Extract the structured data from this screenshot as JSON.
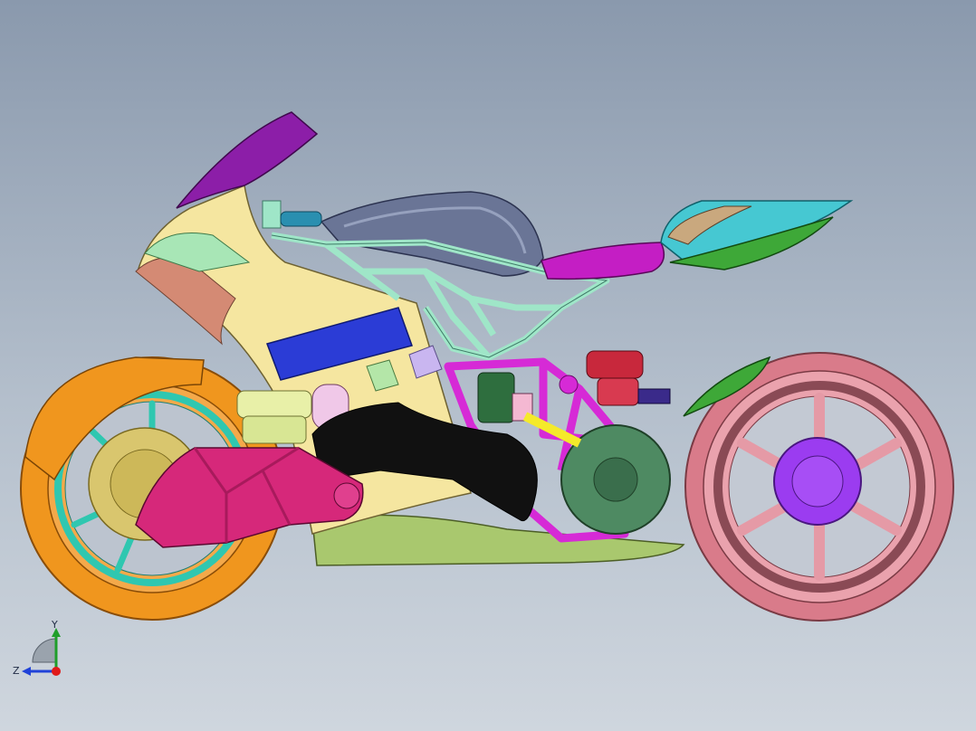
{
  "viewport": {
    "background_top": "#8a99ad",
    "background_bottom": "#cfd6de"
  },
  "model": {
    "name": "motorcycle-assembly",
    "colors": {
      "front_tire": "#f0961e",
      "front_rim": "#2fc7b0",
      "rear_tire": "#e6909c",
      "rear_hub": "#9b3cf0",
      "fairing": "#f5e6a0",
      "windscreen": "#8c1ea8",
      "tank": "#6a7596",
      "lattice_frame": "#9fe6c8",
      "rear_frame": "#d62ad6",
      "swingarm": "#d6287a",
      "seat": "#c41ec4",
      "tail": "#46c8d2",
      "tail_green": "#3ea838",
      "blue_panel": "#2b3cd6",
      "engine_cover": "#111111",
      "belly_pan": "#a9c86e",
      "motor": "#4e8a62",
      "shock_spring": "#c8283c"
    }
  },
  "triad": {
    "y_label": "Y",
    "z_label": "Z",
    "y_color": "#1f9e2a",
    "z_color": "#2042d8",
    "x_color": "#e01a1a"
  }
}
